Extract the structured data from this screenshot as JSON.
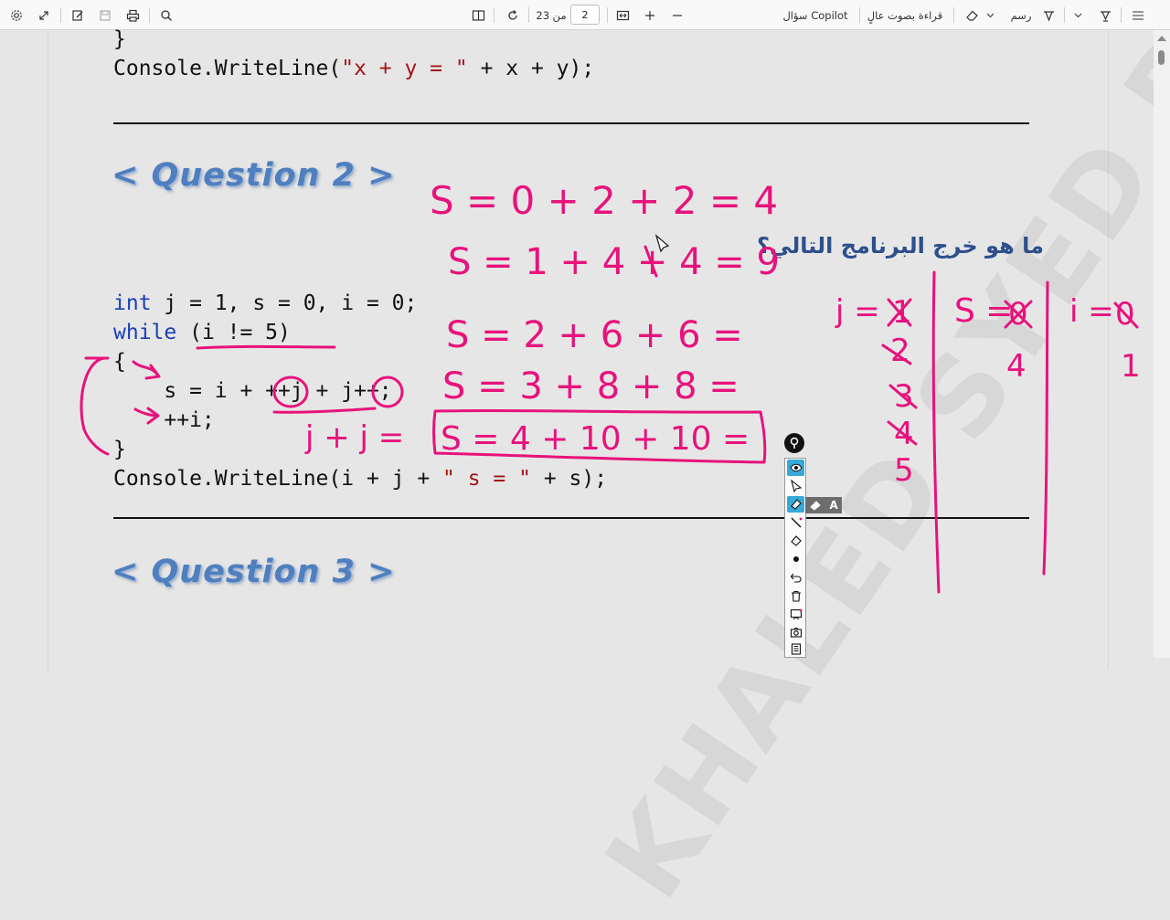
{
  "toolbar": {
    "page_current": "2",
    "page_of": "من 23",
    "ask_copilot": "سؤال Copilot",
    "read_aloud": "قراءة بصوت عالٍ",
    "draw": "رسم"
  },
  "code": {
    "brace_close_top": "}",
    "writeline_1_prefix": "Console.WriteLine(",
    "writeline_1_str": "\"x + y = \"",
    "writeline_1_suffix": " + x + y);",
    "line_decl_kw": "int",
    "line_decl_rest": " j = 1, s = 0, i = 0;",
    "line_while_kw": "while",
    "line_while_rest": " (i != 5)",
    "brace_open": "{",
    "line_assign": "    s = i + ++j + j++;",
    "line_incr": "    ++i;",
    "brace_close": "}",
    "writeline_2_prefix": "Console.WriteLine(i + j + ",
    "writeline_2_str": "\" s = \"",
    "writeline_2_suffix": " + s);"
  },
  "headings": {
    "question_2": "< Question 2 >",
    "question_3": "< Question 3 >"
  },
  "arabic_question": "ما هو خرج البرنامج التالي؟",
  "watermark": "KHALED SYED RAMI",
  "handwriting": {
    "line1": "S = 0 + 2 + 2  = 4",
    "line2": "S = 1 + 4 + 4 = 9",
    "line3": "S = 2 + 6 + 6 =",
    "line4": "S = 3 + 8 + 8 =",
    "line5": "S = 4 + 10 + 10 =",
    "jj": "j + j =",
    "j_label": "j =",
    "s_label": "S =",
    "i_label": "i =",
    "j_values": [
      "1",
      "2",
      "3",
      "4",
      "5"
    ],
    "s_values": [
      "0",
      "4"
    ],
    "i_values": [
      "0",
      "1"
    ]
  },
  "colors": {
    "ink": "#e8127c",
    "keyword": "#1a3fb3",
    "string": "#a31515",
    "heading": "#4f7fbf",
    "arabic": "#2d4f8c"
  }
}
